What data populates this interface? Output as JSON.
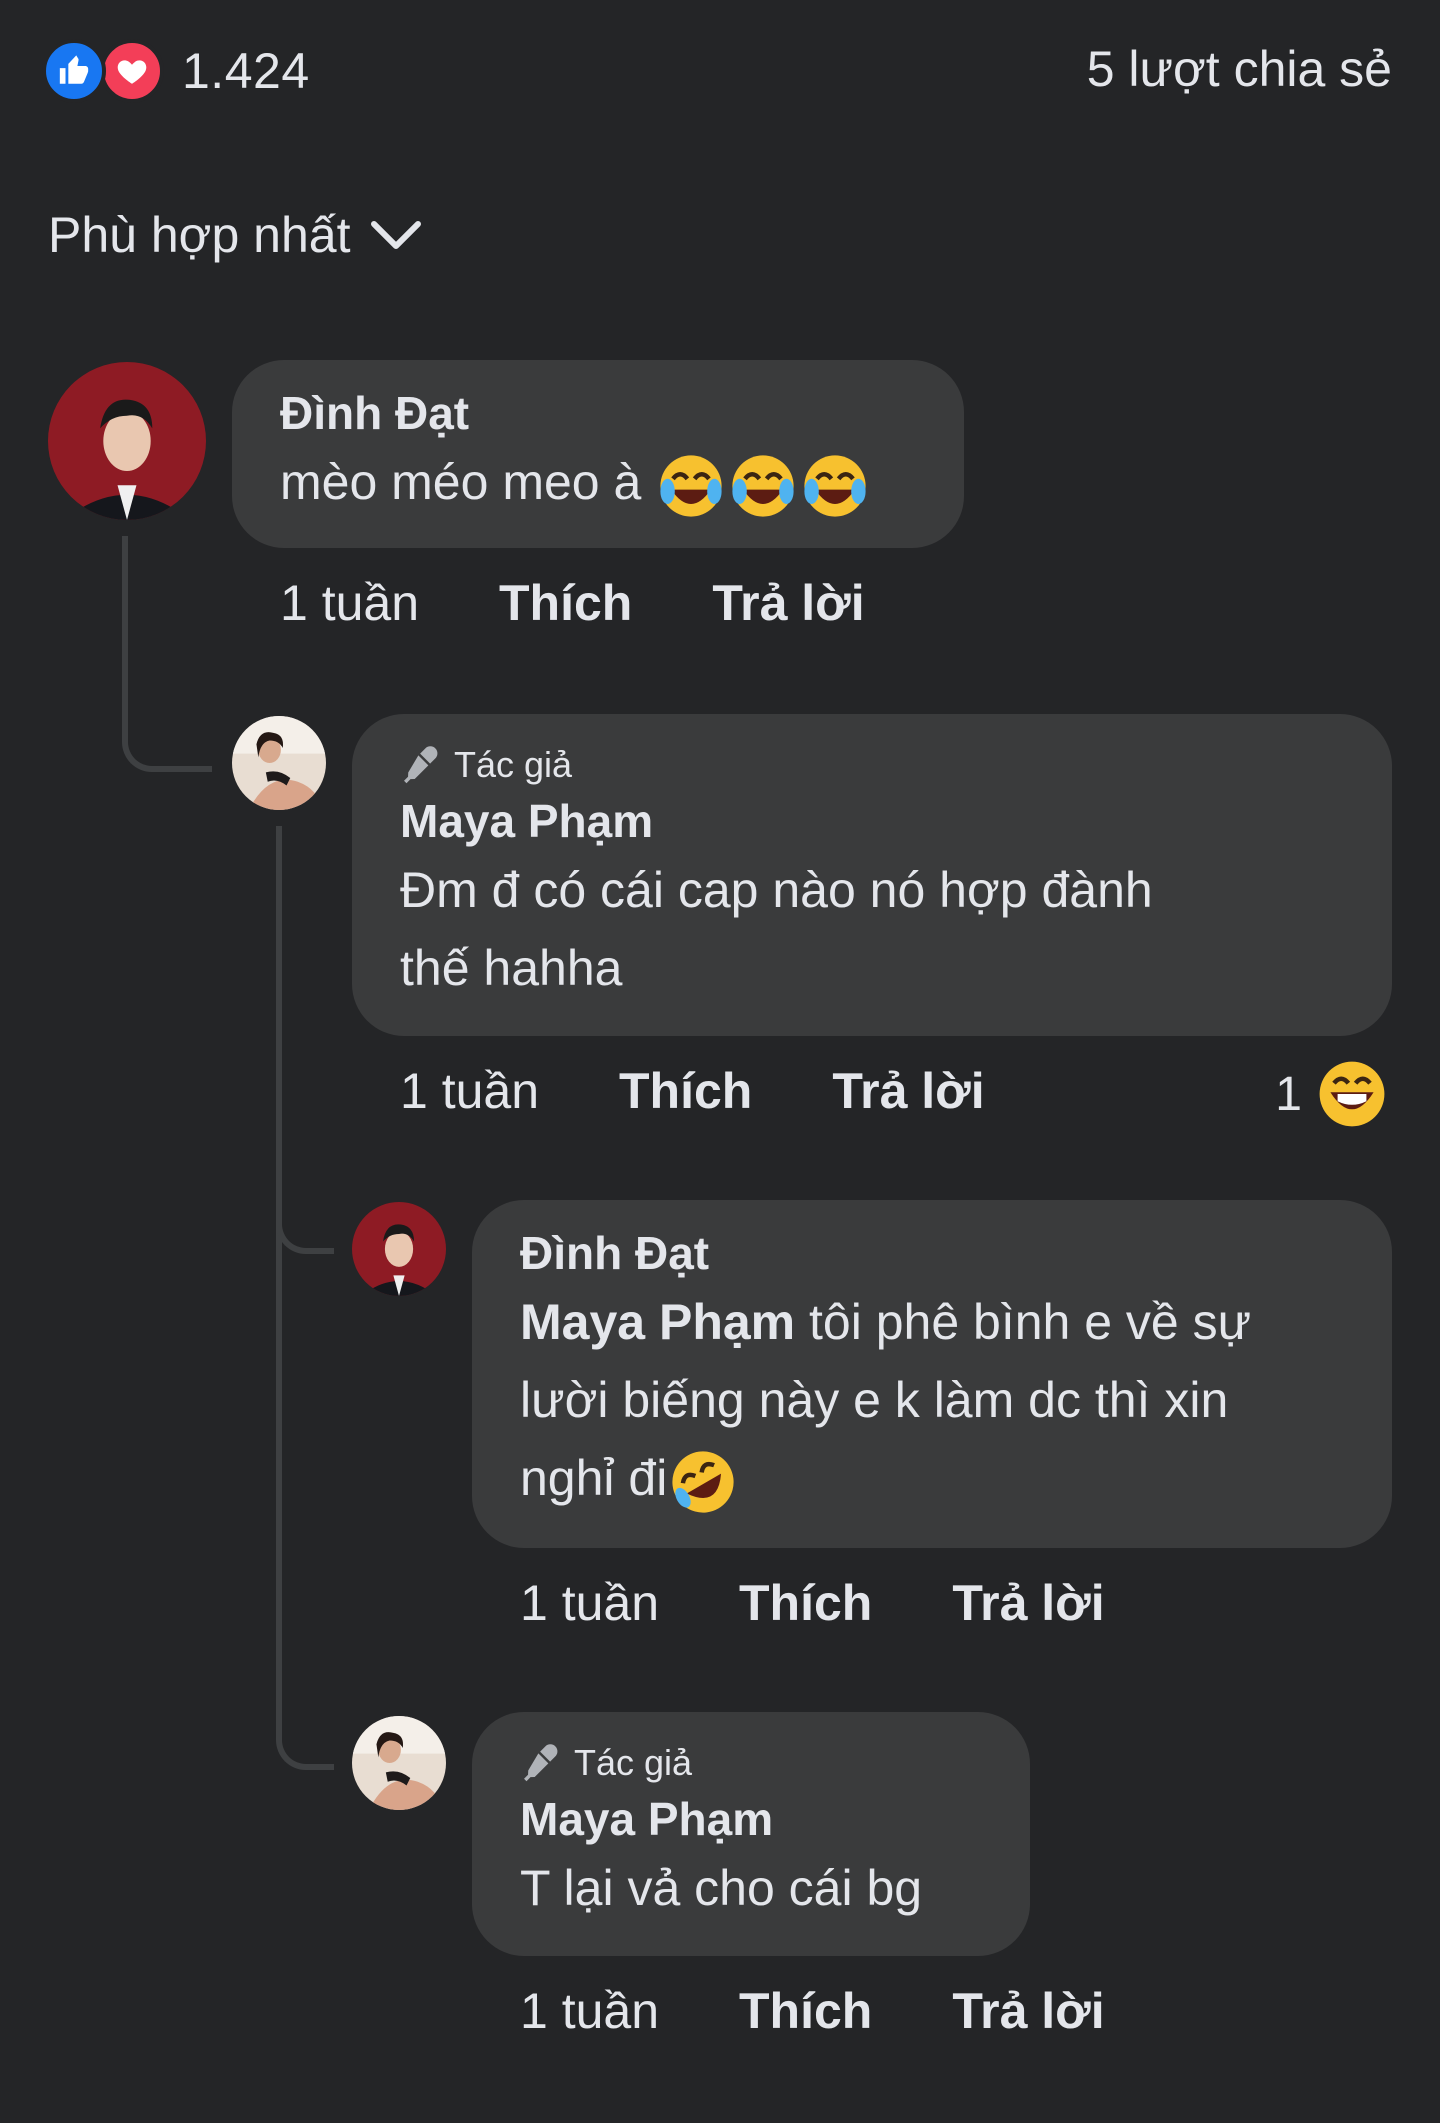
{
  "post_stats": {
    "reaction_count": "1.424",
    "shares": "5 lượt chia sẻ",
    "reaction_icons": [
      "like-icon",
      "love-icon"
    ]
  },
  "sort": {
    "label": "Phù hợp nhất"
  },
  "comments": [
    {
      "author": "Đình Đạt",
      "text": "mèo méo meo à",
      "emojis": [
        "joy",
        "joy",
        "joy"
      ],
      "time": "1 tuần",
      "like": "Thích",
      "reply": "Trả lời",
      "replies": [
        {
          "badge": "Tác giả",
          "author": "Maya Phạm",
          "text_line1": "Đm đ có cái cap nào nó hợp đành",
          "text_line2": "thế hahha",
          "time": "1 tuần",
          "like": "Thích",
          "reply": "Trả lời",
          "reaction_count": "1",
          "reaction": "haha"
        },
        {
          "author": "Đình Đạt",
          "mention": "Maya Phạm",
          "text_line1": " tôi phê bình e về sự",
          "text_line2": "lười biếng này e k làm dc thì xin",
          "text_line3": "nghỉ đi",
          "emojis": [
            "rofl"
          ],
          "time": "1 tuần",
          "like": "Thích",
          "reply": "Trả lời"
        },
        {
          "badge": "Tác giả",
          "author": "Maya Phạm",
          "text": "T lại vả cho cái bg",
          "time": "1 tuần",
          "like": "Thích",
          "reply": "Trả lời"
        }
      ]
    }
  ],
  "colors": {
    "background": "#242527",
    "bubble": "#3a3b3c",
    "text": "#e4e6eb",
    "like_blue": "#1877f2",
    "love_red": "#f33e58"
  }
}
